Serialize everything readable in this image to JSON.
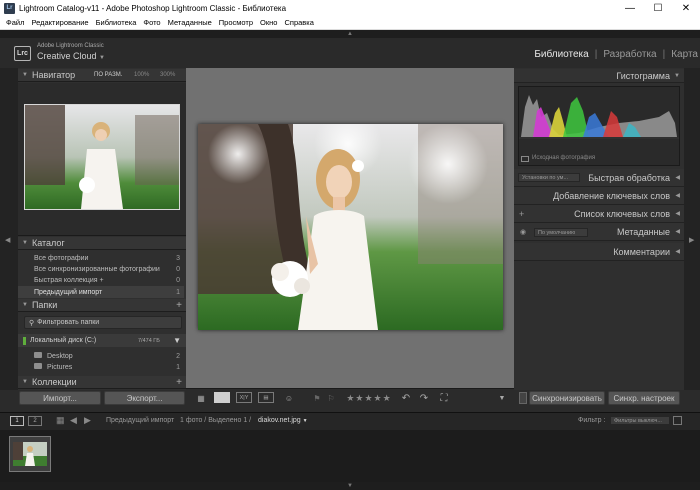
{
  "window": {
    "title": "Lightroom Catalog-v11 - Adobe Photoshop Lightroom Classic - Библиотека",
    "app_icon": "Lr",
    "minimize": "—",
    "maximize": "☐",
    "close": "✕"
  },
  "menu": [
    "Файл",
    "Редактирование",
    "Библиотека",
    "Фото",
    "Метаданные",
    "Просмотр",
    "Окно",
    "Справка"
  ],
  "identity": {
    "badge": "Lrc",
    "line1": "Adobe Lightroom Classic",
    "line2": "Creative Cloud"
  },
  "modules": {
    "library": "Библиотека",
    "develop": "Разработка",
    "map": "Карта"
  },
  "navigator": {
    "title": "Навигатор",
    "zoom_fit": "ПО РАЗМ.",
    "zoom_100": "100%",
    "zoom_300": "300%"
  },
  "catalog": {
    "title": "Каталог",
    "items": [
      {
        "label": "Все фотографии",
        "count": "3"
      },
      {
        "label": "Все синхронизированные фотографии",
        "count": "0"
      },
      {
        "label": "Быстрая коллекция  +",
        "count": "0"
      },
      {
        "label": "Предыдущий импорт",
        "count": "1"
      }
    ]
  },
  "folders": {
    "title": "Папки",
    "filter": "Фильтровать папки",
    "disk_label": "Локальный диск (C:)",
    "disk_free": "7/474 ГБ",
    "items": [
      {
        "label": "Desktop",
        "count": "2"
      },
      {
        "label": "Pictures",
        "count": "1"
      }
    ]
  },
  "collections": {
    "title": "Коллекции"
  },
  "left_buttons": {
    "import": "Импорт...",
    "export": "Экспорт..."
  },
  "right_panel": {
    "histogram": "Гистограмма",
    "original_photo": "Исходная фотография",
    "saved_preset": "Установки по ум...",
    "quick_develop": "Быстрая обработка",
    "keywording": "Добавление ключевых слов",
    "keyword_list": "Список ключевых слов",
    "metadata_preset": "По умолчанию",
    "metadata": "Метаданные",
    "comments": "Комментарии",
    "sync": "Синхронизировать",
    "sync_settings": "Синхр. настроек"
  },
  "toolbar": {
    "stars": "★★★★★",
    "grid_label": "",
    "compare_label": "X|Y"
  },
  "filmbar": {
    "page1": "1",
    "page2": "2",
    "source": "Предыдущий импорт",
    "count_info": "1 фото / Выделено 1 /",
    "filename": "diakov.net.jpg",
    "filter_label": "Фильтр :",
    "filter_value": "Фильтры выключ..."
  },
  "colors": {
    "panel_bg": "#2f2f2f",
    "center_bg": "#717171",
    "title_active": "#e8e8e8"
  }
}
